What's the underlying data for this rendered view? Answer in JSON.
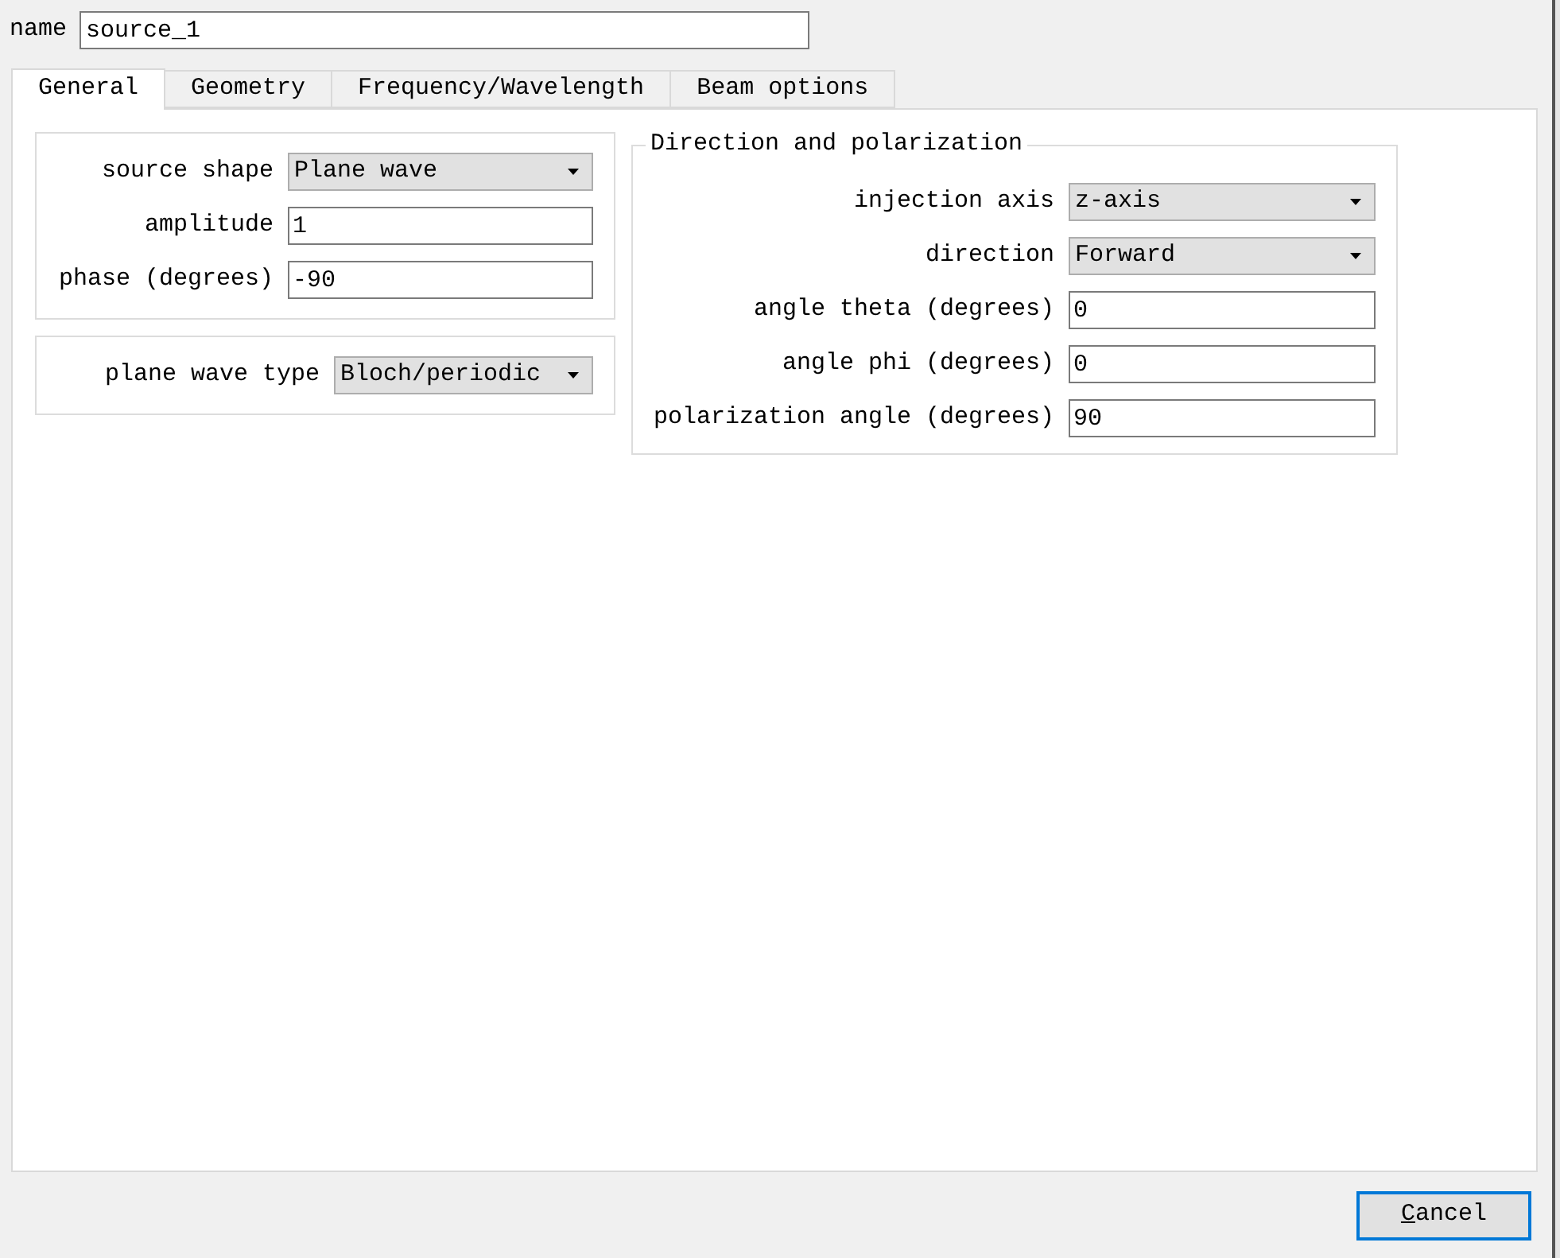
{
  "name_field": {
    "label": "name",
    "value": "source_1"
  },
  "tabs": [
    {
      "label": "General",
      "selected": true
    },
    {
      "label": "Geometry",
      "selected": false
    },
    {
      "label": "Frequency/Wavelength",
      "selected": false
    },
    {
      "label": "Beam options",
      "selected": false
    }
  ],
  "left_groups": [
    {
      "rows": [
        {
          "kind": "dropdown",
          "label": "source shape",
          "value": "Plane wave"
        },
        {
          "kind": "text",
          "label": "amplitude",
          "value": "1"
        },
        {
          "kind": "text",
          "label": "phase (degrees)",
          "value": "-90"
        }
      ]
    },
    {
      "rows": [
        {
          "kind": "dropdown",
          "label": "plane wave type",
          "value": "Bloch/periodic"
        }
      ]
    }
  ],
  "direction_group": {
    "title": "Direction and polarization",
    "rows": [
      {
        "kind": "dropdown",
        "label": "injection axis",
        "value": "z-axis"
      },
      {
        "kind": "dropdown",
        "label": "direction",
        "value": "Forward"
      },
      {
        "kind": "text",
        "label": "angle theta (degrees)",
        "value": "0"
      },
      {
        "kind": "text",
        "label": "angle phi (degrees)",
        "value": "0"
      },
      {
        "kind": "text",
        "label": "polarization angle (degrees)",
        "value": "90"
      }
    ]
  },
  "buttons": [
    {
      "label": "Cancel"
    }
  ]
}
